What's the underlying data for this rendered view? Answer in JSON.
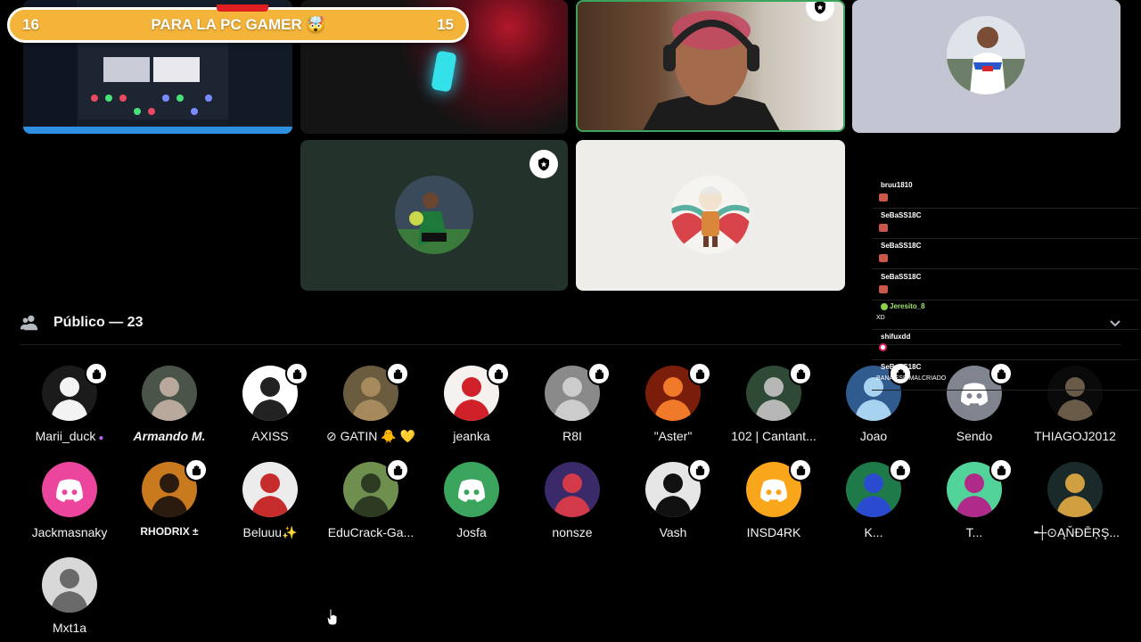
{
  "banner": {
    "left_count": "16",
    "title": "PARA LA PC GAMER 🤯",
    "right_count": "15"
  },
  "audience": {
    "title": "Público — 23"
  },
  "members": [
    {
      "name": "Marii_duck",
      "suffix": "●",
      "bg": "#1b1b1b",
      "color": "#f3f3f3",
      "hand": true
    },
    {
      "name": "Armando M.",
      "style": "italic",
      "bg": "#4a5448",
      "color": "#b9a99c",
      "hand": false
    },
    {
      "name": "AXISS",
      "bg": "#ffffff",
      "color": "#222222",
      "hand": true
    },
    {
      "name": "⊘ GATIN 🐥 💛",
      "bg": "#6b5b3f",
      "color": "#a68a5b",
      "hand": true
    },
    {
      "name": "jeanka",
      "bg": "#f4f1ee",
      "color": "#d0202a",
      "hand": true
    },
    {
      "name": "R8I",
      "bg": "#8a8a8a",
      "color": "#cccccc",
      "hand": true
    },
    {
      "name": "\"Aster\"",
      "bg": "#7a1d0a",
      "color": "#f07a2a",
      "hand": true
    },
    {
      "name": "102 | Cantant...",
      "bg": "#2e4a36",
      "color": "#b7b7b7",
      "hand": true
    },
    {
      "name": "Joao",
      "bg": "#2f5b8f",
      "color": "#a8d3f0",
      "hand": true
    },
    {
      "name": "Sendo",
      "bg": "#80848e",
      "color": "#ffffff",
      "hand": true,
      "discord": true
    },
    {
      "name": "THIAGOJ2012",
      "bg": "#0a0a0a",
      "color": "#6a5a48",
      "hand": false
    },
    {
      "name": "Jackmasnaky",
      "bg": "#eb459e",
      "color": "#ffffff",
      "hand": false,
      "discord": true
    },
    {
      "name": "RHODRIX ±",
      "style": "small",
      "bg": "#c97a1e",
      "color": "#2b1b0e",
      "hand": true
    },
    {
      "name": "Beluuu✨",
      "bg": "#ececec",
      "color": "#c72c2c",
      "hand": false
    },
    {
      "name": "EduCrack-Ga...",
      "bg": "#6e8f4e",
      "color": "#2c3a22",
      "hand": true
    },
    {
      "name": "Josfa",
      "bg": "#3ba55d",
      "color": "#ffffff",
      "hand": false,
      "discord": true
    },
    {
      "name": "nonsze",
      "bg": "#3a2a6a",
      "color": "#d23a4a",
      "hand": false
    },
    {
      "name": "Vash",
      "bg": "#e6e6e6",
      "color": "#111111",
      "hand": true
    },
    {
      "name": "INSD4RK",
      "bg": "#faa61a",
      "color": "#ffffff",
      "hand": true,
      "discord": true
    },
    {
      "name": "K...",
      "bg": "#1f7a4a",
      "color": "#2a4bd0",
      "hand": true
    },
    {
      "name": "T...",
      "bg": "#52d39a",
      "color": "#b02a8a",
      "hand": true
    },
    {
      "name": "╺┼⊙ĄŇĐĒŖŞ...",
      "bg": "#1a2a2a",
      "color": "#d0a040",
      "hand": false
    },
    {
      "name": "Mxt1a",
      "bg": "#d8d8d8",
      "color": "#6a6a6a",
      "hand": false
    }
  ],
  "chat": [
    {
      "name": "bruu1810",
      "emote": true
    },
    {
      "name": "SeBaSS18C",
      "emote": true
    },
    {
      "name": "SeBaSS18C",
      "emote": true
    },
    {
      "name": "SeBaSS18C",
      "emote": true
    },
    {
      "name": "Jeresito_8",
      "text": "XD",
      "badge": true
    },
    {
      "name": "shifuxdd",
      "emote_dot": true
    },
    {
      "name": "SeBaSS18C",
      "text": "BANA ESE MALCRIADO"
    }
  ],
  "icons": {
    "shield": "shield-icon",
    "hand": "raised-hand-icon",
    "audience": "people-icon",
    "chevron": "chevron-down-icon",
    "cursor": "mouse-pointer-icon"
  },
  "colors": {
    "banner": "#f4b43a",
    "speaking_border": "#3ba55d",
    "discord_blurple": "#5865f2"
  }
}
